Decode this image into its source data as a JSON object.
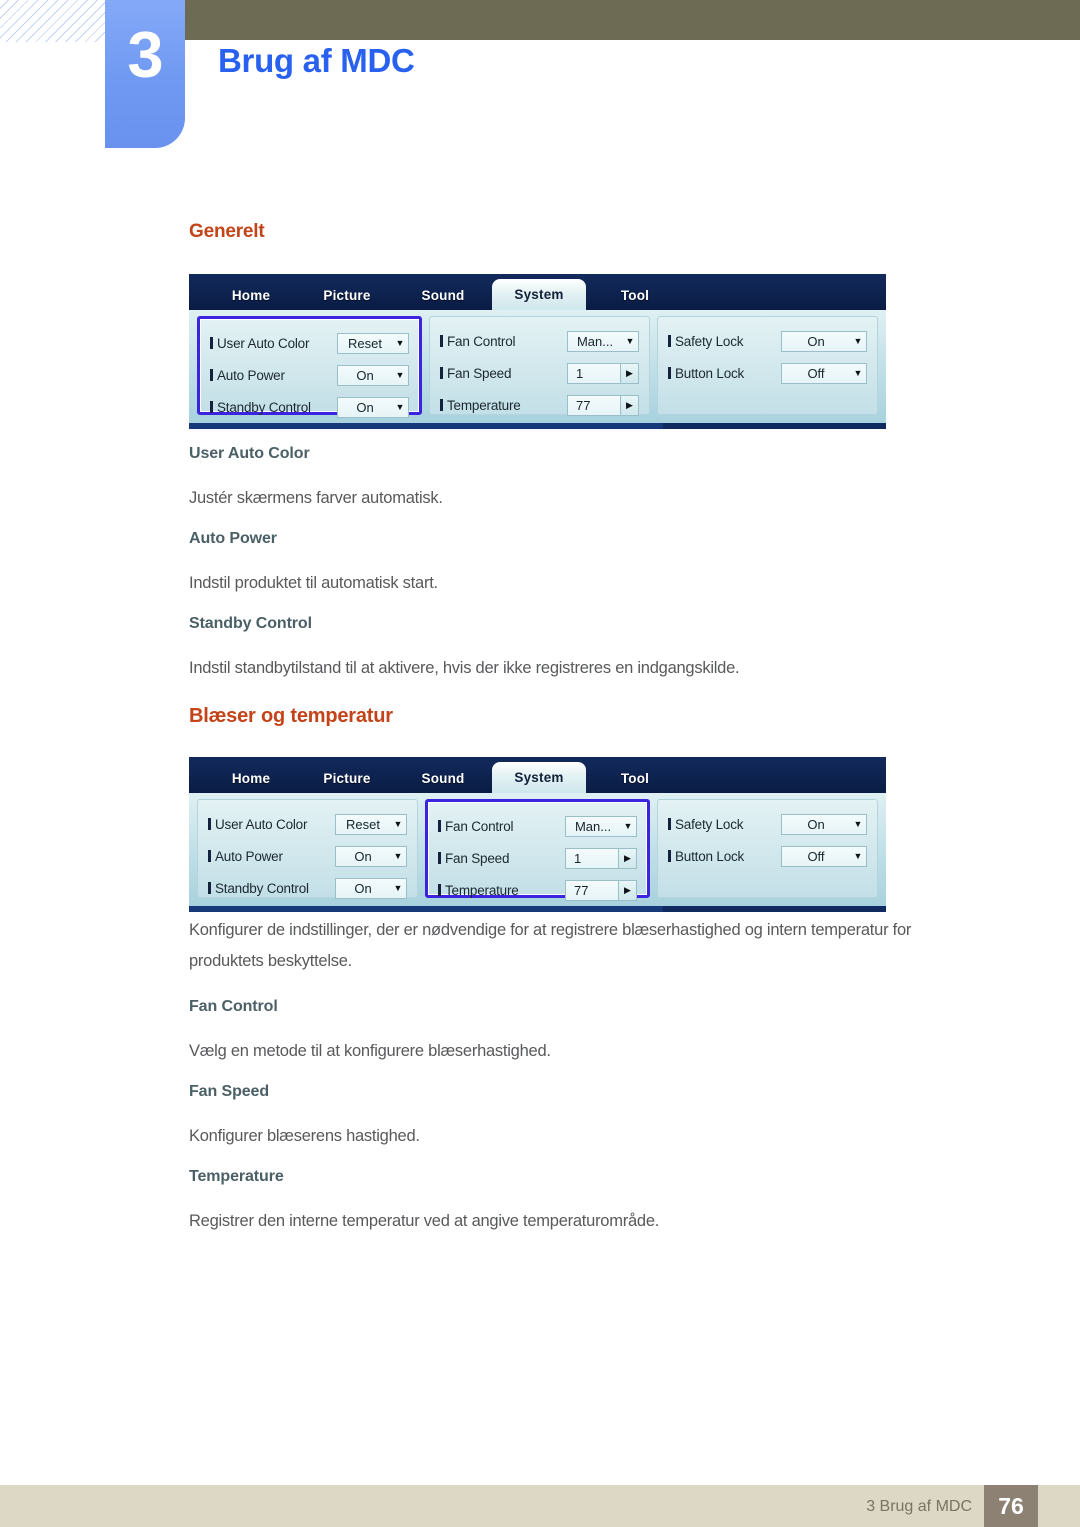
{
  "header": {
    "chapter_number": "3",
    "chapter_title": "Brug af MDC"
  },
  "sections": {
    "generelt": {
      "heading": "Generelt",
      "items": [
        {
          "title": "User Auto Color",
          "body": "Justér skærmens farver automatisk."
        },
        {
          "title": "Auto Power",
          "body": "Indstil produktet til automatisk start."
        },
        {
          "title": "Standby Control",
          "body": "Indstil standbytilstand til at aktivere, hvis der ikke registreres en indgangskilde."
        }
      ]
    },
    "blaeser": {
      "heading": "Blæser og temperatur",
      "intro_line1": "Konfigurer de indstillinger, der er nødvendige for at registrere blæserhastighed og intern temperatur for",
      "intro_line2": "produktets beskyttelse.",
      "items": [
        {
          "title": "Fan Control",
          "body": "Vælg en metode til at konfigurere blæserhastighed."
        },
        {
          "title": "Fan Speed",
          "body": "Konfigurer blæserens hastighed."
        },
        {
          "title": "Temperature",
          "body": "Registrer den interne temperatur ved at angive temperaturområde."
        }
      ]
    }
  },
  "mdc": {
    "tabs": [
      {
        "label": "Home",
        "active": false
      },
      {
        "label": "Picture",
        "active": false
      },
      {
        "label": "Sound",
        "active": false
      },
      {
        "label": "System",
        "active": true
      },
      {
        "label": "Tool",
        "active": false
      }
    ],
    "columns": {
      "left": [
        {
          "label": "User Auto Color",
          "value": "Reset",
          "control": "dropdown"
        },
        {
          "label": "Auto Power",
          "value": "On",
          "control": "dropdown"
        },
        {
          "label": "Standby Control",
          "value": "On",
          "control": "dropdown"
        }
      ],
      "middle": [
        {
          "label": "Fan Control",
          "value": "Man...",
          "control": "dropdown"
        },
        {
          "label": "Fan Speed",
          "value": "1",
          "control": "spinner"
        },
        {
          "label": "Temperature",
          "value": "77",
          "control": "spinner"
        }
      ],
      "right": [
        {
          "label": "Safety Lock",
          "value": "On",
          "control": "dropdown"
        },
        {
          "label": "Button Lock",
          "value": "Off",
          "control": "dropdown"
        }
      ]
    },
    "icons": {
      "dropdown_caret": "▼",
      "spinner_arrow": "▶"
    }
  },
  "footer": {
    "text": "3 Brug af MDC",
    "page_number": "76"
  },
  "colors": {
    "chapter_blue": "#2861ef",
    "heading_orange": "#c4441a",
    "sub_heading": "#4b6066",
    "body_text": "#58595b",
    "olive_bar": "#6e6b54",
    "tab_blue": "#6f99f2",
    "footer_bar": "#ddd8c6",
    "page_box": "#8d8173",
    "highlight_border": "#3a24e0"
  }
}
